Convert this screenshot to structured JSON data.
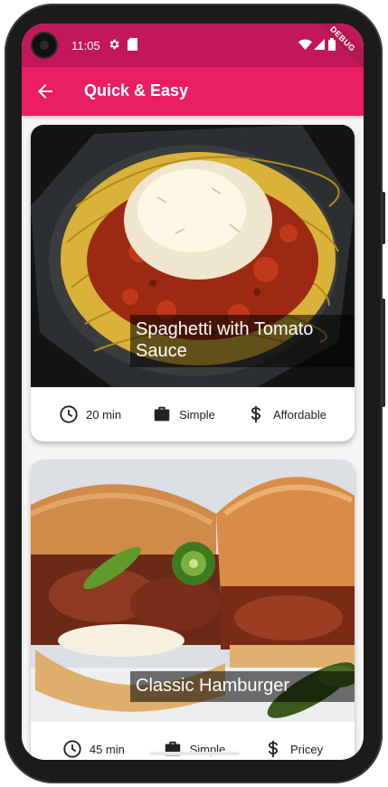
{
  "status": {
    "time": "11:05",
    "debug_label": "DEBUG"
  },
  "appbar": {
    "title": "Quick & Easy"
  },
  "meals": [
    {
      "title": "Spaghetti with Tomato Sauce",
      "duration": "20 min",
      "complexity": "Simple",
      "affordability": "Affordable"
    },
    {
      "title": "Classic Hamburger",
      "duration": "45 min",
      "complexity": "Simple",
      "affordability": "Pricey"
    }
  ],
  "colors": {
    "status_bar": "#c2185b",
    "app_bar": "#e91e63"
  }
}
